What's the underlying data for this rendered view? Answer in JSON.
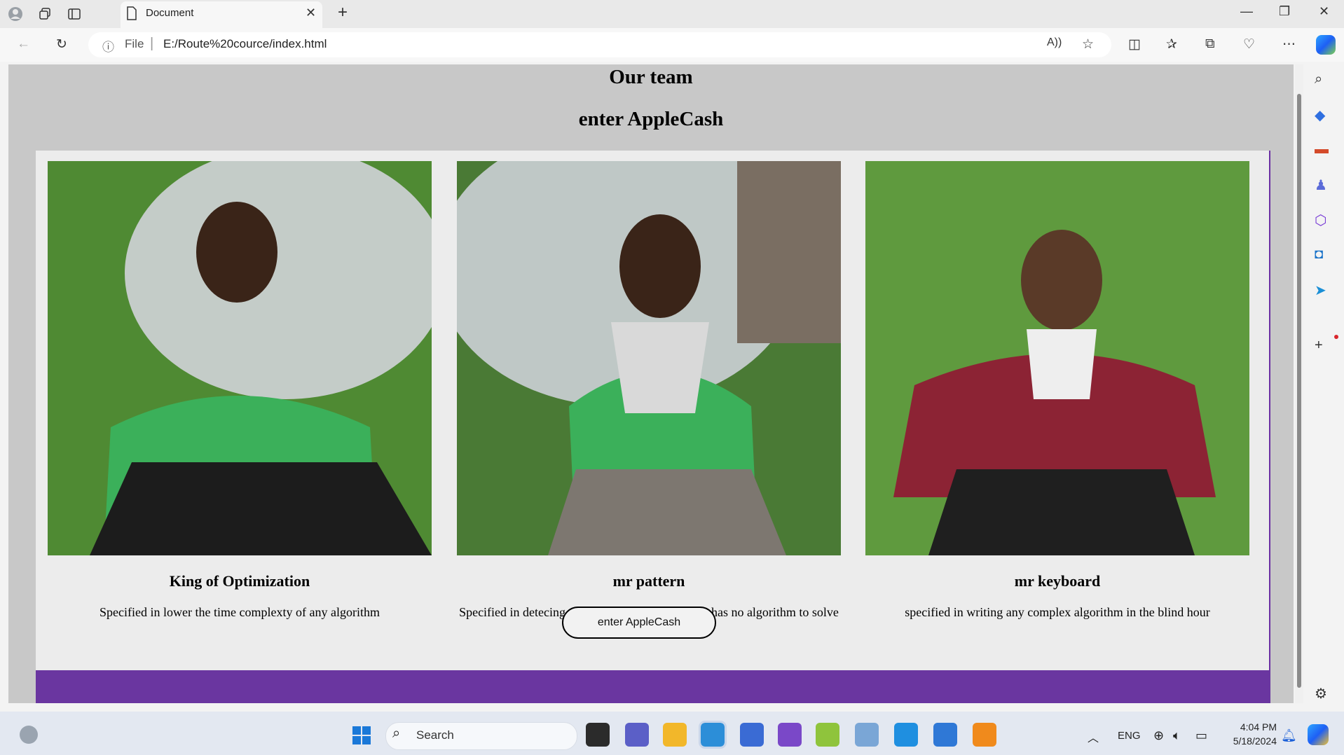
{
  "browser": {
    "tab_title": "Document",
    "address_prefix": "File",
    "address_url": "E:/Route%20cource/index.html",
    "icons": [
      "profile-icon",
      "workspaces-icon",
      "tab-actions-icon",
      "document-icon",
      "close-icon",
      "new-tab-icon",
      "back-icon",
      "reload-icon",
      "info-icon",
      "read-aloud-icon",
      "favorite-star-icon",
      "split-screen-icon",
      "favorites-icon",
      "collections-icon",
      "browser-essentials-icon",
      "more-icon",
      "copilot-icon"
    ]
  },
  "page": {
    "title": "Our team",
    "subtitle": "enter AppleCash",
    "members": [
      {
        "name": "King of Optimization",
        "description": "Specified in lower the time complexty of any algorithm"
      },
      {
        "name": "mr pattern",
        "description": "Specified in detecing the pattern of problems that has no algorithm to solve it"
      },
      {
        "name": "mr keyboard",
        "description": "specified in writing any complex algorithm in the blind hour"
      }
    ],
    "footer_button": "enter AppleCash",
    "colors": {
      "background": "#c8c8c8",
      "panel": "#ececec",
      "footer": "#6a36a0"
    }
  },
  "taskbar": {
    "search_label": "Search",
    "language": "ENG",
    "time": "4:04 PM",
    "date": "5/18/2024"
  }
}
